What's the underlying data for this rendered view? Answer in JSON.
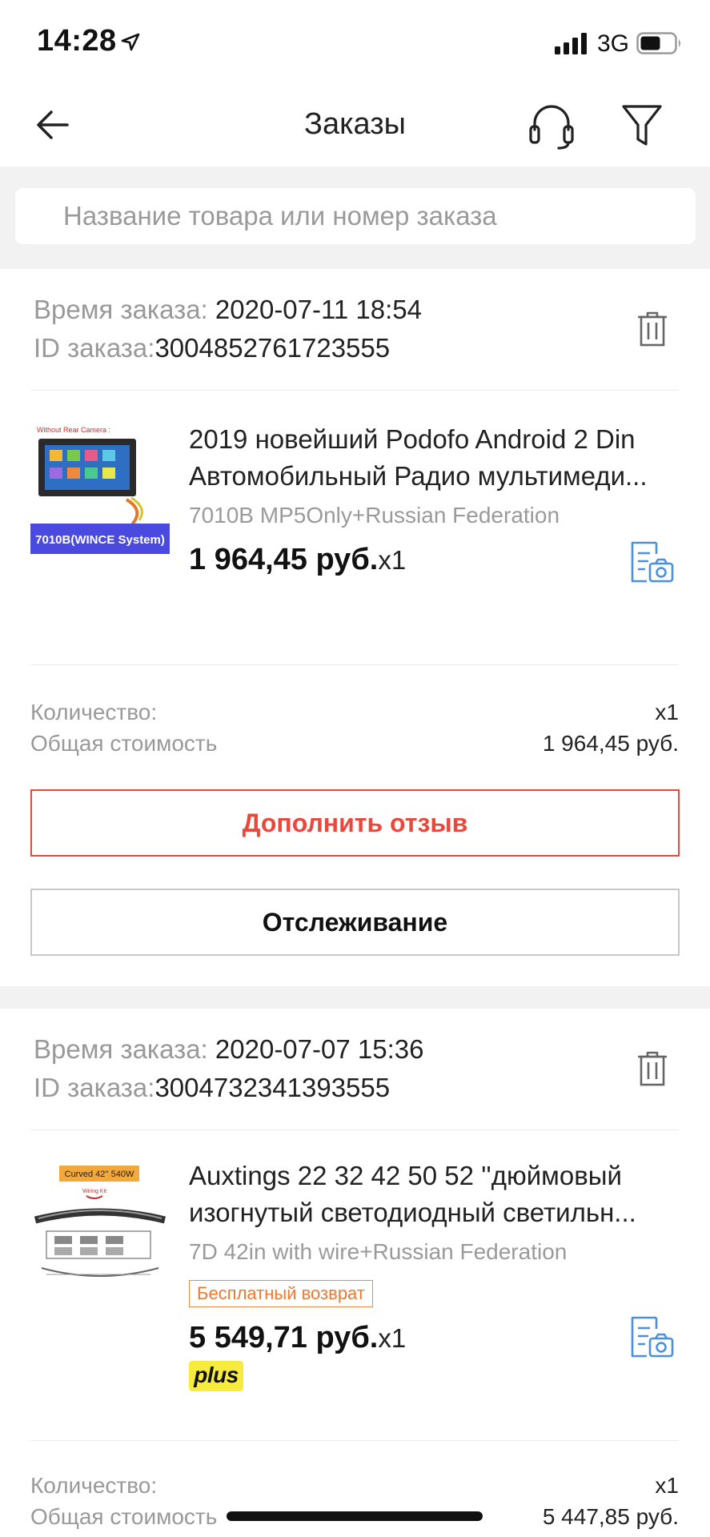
{
  "status_bar": {
    "time": "14:28",
    "network": "3G",
    "icons": [
      "location-arrow-icon",
      "signal-bars-icon",
      "battery-icon"
    ]
  },
  "nav": {
    "title": "Заказы",
    "icons": [
      "back-arrow-icon",
      "headset-icon",
      "filter-funnel-icon"
    ]
  },
  "search": {
    "placeholder": "Название товара или номер заказа"
  },
  "colors": {
    "accent_red": "#e8493c",
    "icon_blue": "#4a8fe0",
    "free_return_orange": "#f0782e",
    "plus_yellow": "#f7ec3c",
    "band_gray": "#f2f2f2"
  },
  "orders": [
    {
      "time_label": "Время заказа:",
      "time_value": " 2020-07-11 18:54",
      "id_label": "ID заказа:",
      "id_value": "3004852761723555",
      "thumb": {
        "top_caption": "Without Rear Camera :",
        "bottom_label": "7010B(WINCE System)"
      },
      "title_line1": "2019 новейший Podofo Android 2 Din",
      "title_line2": "Автомобильный Радио мультимеди...",
      "variant": "7010B MP5Only+Russian Federation",
      "price": "1 964,45 руб.",
      "qty": "x1",
      "summary": {
        "qty_label": "Количество:",
        "qty_value": "x1",
        "total_label": "Общая стоимость",
        "total_value": "1 964,45 руб."
      },
      "buttons": {
        "review": "Дополнить отзыв",
        "track": "Отслеживание"
      }
    },
    {
      "time_label": "Время заказа:",
      "time_value": " 2020-07-07 15:36",
      "id_label": "ID заказа:",
      "id_value": "3004732341393555",
      "thumb": {
        "top_caption": "Curved 42'' 540W",
        "sub_caption": "Wiring Kit"
      },
      "title_line1": "Auxtings 22 32 42 50 52 ''дюймовый",
      "title_line2": "изогнутый светодиодный светильн...",
      "variant": "7D 42in with wire+Russian Federation",
      "free_return": "Бесплатный возврат",
      "price": "5 549,71 руб.",
      "qty": "x1",
      "plus_badge": "plus",
      "summary": {
        "qty_label": "Количество:",
        "qty_value": "x1",
        "total_label": "Общая стоимость",
        "total_value": "5 447,85 руб."
      }
    }
  ]
}
